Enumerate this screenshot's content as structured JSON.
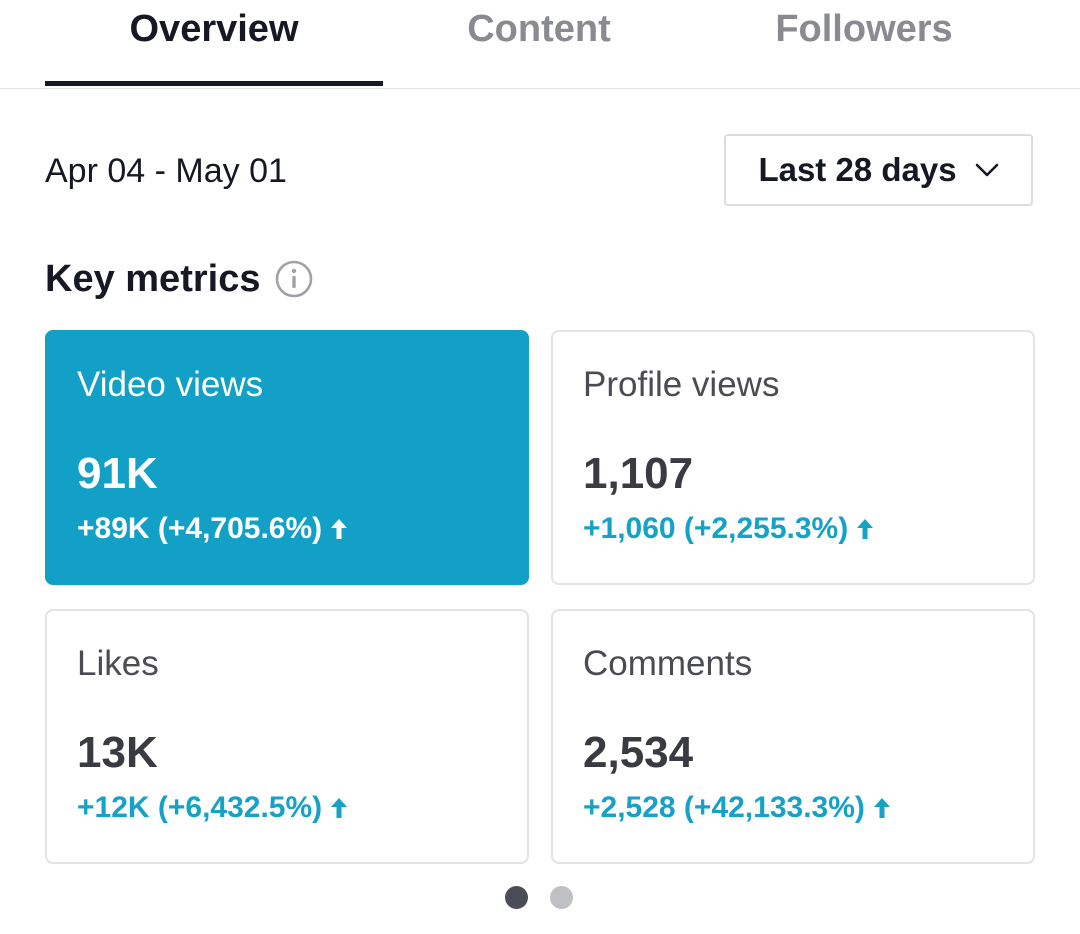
{
  "tabs": [
    {
      "label": "Overview",
      "active": true
    },
    {
      "label": "Content",
      "active": false
    },
    {
      "label": "Followers",
      "active": false
    }
  ],
  "date_range": "Apr 04 - May 01",
  "period_select": {
    "label": "Last 28 days",
    "icon": "chevron-down-icon"
  },
  "key_metrics": {
    "title": "Key metrics",
    "info_icon": "info-icon",
    "cards": [
      {
        "label": "Video views",
        "value": "91K",
        "change": "+89K (+4,705.6%)",
        "selected": true
      },
      {
        "label": "Profile views",
        "value": "1,107",
        "change": "+1,060 (+2,255.3%)",
        "selected": false
      },
      {
        "label": "Likes",
        "value": "13K",
        "change": "+12K (+6,432.5%)",
        "selected": false
      },
      {
        "label": "Comments",
        "value": "2,534",
        "change": "+2,528 (+42,133.3%)",
        "selected": false
      }
    ]
  },
  "pagination": {
    "pages": 2,
    "active_page": 1
  },
  "colors": {
    "accent": "#12a0c6",
    "positive_change": "#15a2c6",
    "text_primary": "#161823",
    "text_muted": "#8a8b91",
    "border": "#e3e3e4",
    "dot_active": "#4a4d57",
    "dot_inactive": "#bfc0c4"
  }
}
